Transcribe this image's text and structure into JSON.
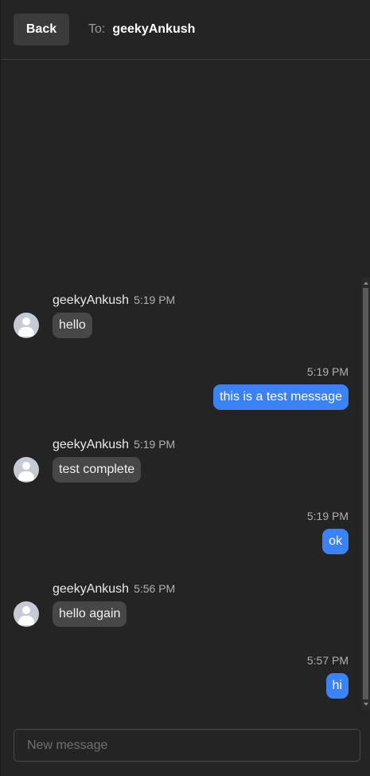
{
  "header": {
    "back_label": "Back",
    "to_label": "To:",
    "recipient": "geekyAnkush"
  },
  "messages": [
    {
      "direction": "in",
      "sender": "geekyAnkush",
      "time": "5:19 PM",
      "text": "hello"
    },
    {
      "direction": "out",
      "time": "5:19 PM",
      "text": "this is a test message"
    },
    {
      "direction": "in",
      "sender": "geekyAnkush",
      "time": "5:19 PM",
      "text": "test complete"
    },
    {
      "direction": "out",
      "time": "5:19 PM",
      "text": "ok"
    },
    {
      "direction": "in",
      "sender": "geekyAnkush",
      "time": "5:56 PM",
      "text": "hello again"
    },
    {
      "direction": "out",
      "time": "5:57 PM",
      "text": "hi"
    }
  ],
  "composer": {
    "placeholder": "New message",
    "value": ""
  },
  "colors": {
    "background": "#242424",
    "outgoing_bubble": "#3b82f6",
    "incoming_bubble": "#474747"
  }
}
